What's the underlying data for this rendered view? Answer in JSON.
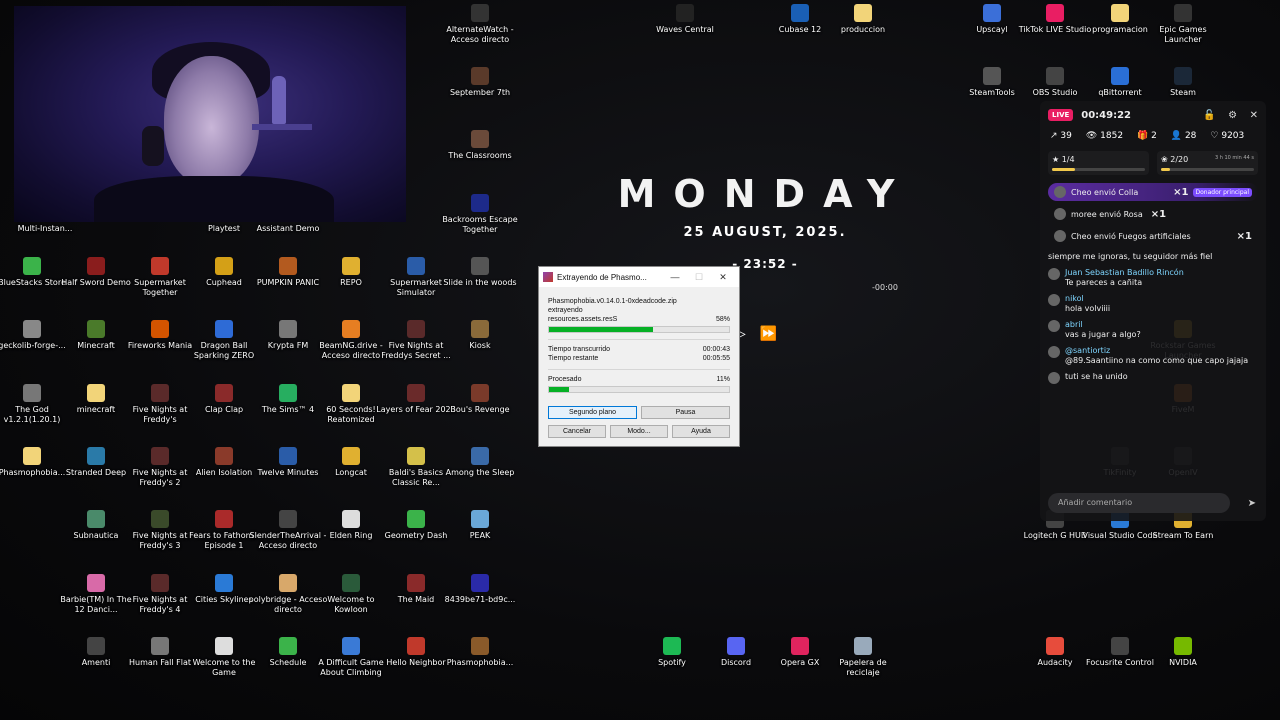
{
  "desktop_icons": [
    {
      "label": "AlternateWatch - Acceso directo",
      "color": "#333"
    },
    {
      "label": "Waves Central",
      "color": "#222"
    },
    {
      "label": "Cubase 12",
      "color": "#1a5fb4"
    },
    {
      "label": "produccion",
      "color": "#f2d479"
    },
    {
      "label": "Upscayl",
      "color": "#3b6fd8"
    },
    {
      "label": "TikTok LIVE Studio",
      "color": "#e91e63"
    },
    {
      "label": "programacion",
      "color": "#f2d479"
    },
    {
      "label": "Epic Games Launcher",
      "color": "#333"
    },
    {
      "label": "SteamTools",
      "color": "#555"
    },
    {
      "label": "OBS Studio",
      "color": "#444"
    },
    {
      "label": "qBittorrent",
      "color": "#2a6fd6"
    },
    {
      "label": "Steam",
      "color": "#1b2838"
    },
    {
      "label": "September 7th",
      "color": "#5a3a2a"
    },
    {
      "label": "The Classrooms",
      "color": "#6a4a3a"
    },
    {
      "label": "Backrooms Escape Together",
      "color": "#1d2a8a"
    },
    {
      "label": "Multi-Instan...",
      "color": "#444"
    },
    {
      "label": "Playtest",
      "color": "#444"
    },
    {
      "label": "Assistant Demo",
      "color": "#444"
    },
    {
      "label": "BlueStacks Store",
      "color": "#3bb34a"
    },
    {
      "label": "Half Sword Demo",
      "color": "#8a1d1d"
    },
    {
      "label": "Supermarket Together",
      "color": "#c0392b"
    },
    {
      "label": "Cuphead",
      "color": "#d4a017"
    },
    {
      "label": "PUMPKIN PANIC",
      "color": "#b35a1f"
    },
    {
      "label": "REPO",
      "color": "#e0b030"
    },
    {
      "label": "Supermarket Simulator",
      "color": "#2a5ca8"
    },
    {
      "label": "Slide in the woods",
      "color": "#555"
    },
    {
      "label": "geckolib-forge-...",
      "color": "#888"
    },
    {
      "label": "Minecraft",
      "color": "#4a7a2a"
    },
    {
      "label": "Fireworks Mania",
      "color": "#d35400"
    },
    {
      "label": "Dragon Ball Sparking ZERO",
      "color": "#2e6bd6"
    },
    {
      "label": "Krypta FM",
      "color": "#777"
    },
    {
      "label": "BeamNG.drive - Acceso directo",
      "color": "#e67e22"
    },
    {
      "label": "Five Nights at Freddys Secret ...",
      "color": "#5a2a2a"
    },
    {
      "label": "Kiosk",
      "color": "#8a6a3a"
    },
    {
      "label": "The God v1.2.1(1.20.1)",
      "color": "#777"
    },
    {
      "label": "minecraft",
      "color": "#f2d479"
    },
    {
      "label": "Five Nights at Freddy's",
      "color": "#5a2a2a"
    },
    {
      "label": "Clap Clap",
      "color": "#8a2a2a"
    },
    {
      "label": "The Sims™ 4",
      "color": "#27ae60"
    },
    {
      "label": "60 Seconds! Reatomized",
      "color": "#f2d479"
    },
    {
      "label": "Layers of Fear 2023",
      "color": "#6a2a2a"
    },
    {
      "label": "Bou's Revenge",
      "color": "#7a3a2a"
    },
    {
      "label": "Phasmophobia...",
      "color": "#f2d479"
    },
    {
      "label": "Stranded Deep",
      "color": "#2a7aa8"
    },
    {
      "label": "Five Nights at Freddy's 2",
      "color": "#5a2a2a"
    },
    {
      "label": "Alien Isolation",
      "color": "#8a3a2a"
    },
    {
      "label": "Twelve Minutes",
      "color": "#2a5ca8"
    },
    {
      "label": "Longcat",
      "color": "#e0b030"
    },
    {
      "label": "Baldi's Basics Classic Re...",
      "color": "#d4c04a"
    },
    {
      "label": "Among the Sleep",
      "color": "#3a6aa8"
    },
    {
      "label": "Subnautica",
      "color": "#4a8a6a"
    },
    {
      "label": "Five Nights at Freddy's 3",
      "color": "#3a4a2a"
    },
    {
      "label": "Fears to Fathom - Episode 1",
      "color": "#aa2a2a"
    },
    {
      "label": "SlenderTheArrival - Acceso directo",
      "color": "#444"
    },
    {
      "label": "Elden Ring",
      "color": "#ddd"
    },
    {
      "label": "Geometry Dash",
      "color": "#3bb34a"
    },
    {
      "label": "PEAK",
      "color": "#6aa8d8"
    },
    {
      "label": "Barbie(TM) In The 12 Danci...",
      "color": "#d86aa8"
    },
    {
      "label": "Five Nights at Freddy's 4",
      "color": "#5a2a2a"
    },
    {
      "label": "Cities Skylines",
      "color": "#2a7ad6"
    },
    {
      "label": "polybridge - Acceso directo",
      "color": "#d8a86a"
    },
    {
      "label": "Welcome to Kowloon",
      "color": "#2a5a3a"
    },
    {
      "label": "The Maid",
      "color": "#8a2a2a"
    },
    {
      "label": "8439be71-bd9c...",
      "color": "#2a2aa8"
    },
    {
      "label": "Amenti",
      "color": "#444"
    },
    {
      "label": "Human Fall Flat",
      "color": "#777"
    },
    {
      "label": "Welcome to the Game",
      "color": "#ddd"
    },
    {
      "label": "Schedule",
      "color": "#3bb34a"
    },
    {
      "label": "A Difficult Game About Climbing",
      "color": "#3a7ad6"
    },
    {
      "label": "Hello Neighbor",
      "color": "#c0392b"
    },
    {
      "label": "Phasmophobia...",
      "color": "#8a5a2a"
    },
    {
      "label": "Spotify",
      "color": "#1db954"
    },
    {
      "label": "Discord",
      "color": "#5865f2"
    },
    {
      "label": "Opera GX",
      "color": "#e0245e"
    },
    {
      "label": "Papelera de reciclaje",
      "color": "#9ab"
    },
    {
      "label": "Logitech G HUB",
      "color": "#444"
    },
    {
      "label": "Visual Studio Code",
      "color": "#2a7ad6"
    },
    {
      "label": "Stream To Earn",
      "color": "#e0b030"
    },
    {
      "label": "Audacity",
      "color": "#e74c3c"
    },
    {
      "label": "Focusrite Control",
      "color": "#444"
    },
    {
      "label": "NVIDIA",
      "color": "#76b900"
    },
    {
      "label": "Rockstar Games Launcher",
      "color": "#e0b030"
    },
    {
      "label": "FiveM",
      "color": "#e67e22"
    },
    {
      "label": "TikFinity",
      "color": "#444"
    },
    {
      "label": "OpenIV",
      "color": "#444"
    }
  ],
  "clock": {
    "day": "MONDAY",
    "date": "25 AUGUST, 2025.",
    "time": "- 23:52 -",
    "media_time": "-00:00"
  },
  "dialog": {
    "title": "Extrayendo de Phasmo...",
    "file": "Phasmophobia.v0.14.0.1-0xdeadcode.zip",
    "action": "extrayendo",
    "current_file": "resources.assets.resS",
    "file_percent": "58%",
    "file_progress": 0.58,
    "elapsed_label": "Tiempo transcurrido",
    "elapsed_value": "00:00:43",
    "remaining_label": "Tiempo restante",
    "remaining_value": "00:05:55",
    "processed_label": "Procesado",
    "processed_percent": "11%",
    "processed_progress": 0.11,
    "btn_background": "Segundo plano",
    "btn_pause": "Pausa",
    "btn_cancel": "Cancelar",
    "btn_mode": "Modo...",
    "btn_help": "Ayuda"
  },
  "live": {
    "badge": "LIVE",
    "duration": "00:49:22",
    "stats": {
      "shares": "39",
      "views": "1852",
      "gifts": "2",
      "follows": "28",
      "likes": "9203"
    },
    "goal1": "1/4",
    "goal1_progress": 0.25,
    "goal2": "2/20",
    "goal2_progress": 0.1,
    "goal2_timer": "3 h 10 min 44 s",
    "gifts": [
      {
        "user": "Cheo",
        "text": "envió Colla",
        "mult": "×1",
        "badge": "Donador principal"
      },
      {
        "user": "moree",
        "text": "envió Rosa",
        "mult": "×1"
      },
      {
        "user": "Cheo",
        "text": "envió Fuegos artificiales",
        "mult": "×1"
      }
    ],
    "messages": [
      {
        "user": "",
        "text": "siempre me ignoras, tu seguidor más fiel"
      },
      {
        "user": "Juan Sebastian Badillo Rincón",
        "text": "Te pareces a cañita"
      },
      {
        "user": "nikol",
        "text": "hola volviiii"
      },
      {
        "user": "abril",
        "text": "vas a jugar a algo?"
      },
      {
        "user": "@santiortiz",
        "text": "@89.Saantiino na como como que capo jajaja"
      },
      {
        "user": "tuti",
        "text": "se ha unido"
      }
    ],
    "comment_placeholder": "Añadir comentario"
  }
}
